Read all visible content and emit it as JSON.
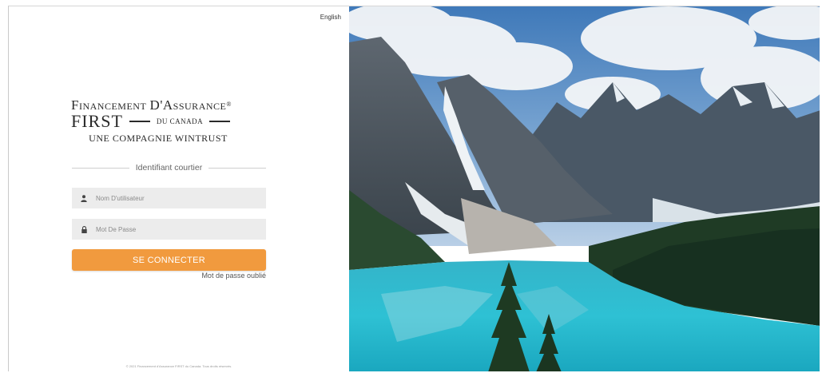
{
  "language_link": "English",
  "logo": {
    "line1_prefix": "F",
    "line1_rest": "INANCEMENT",
    "line1_d": "D'A",
    "line1_rest2": "SSURANCE",
    "registered": "®",
    "line2_first": "FIRST",
    "line2_canada": "DU CANADA",
    "line3": "UNE COMPAGNIE WINTRUST"
  },
  "form": {
    "section_title": "Identifiant courtier",
    "username_placeholder": "Nom D'utilisateur",
    "password_placeholder": "Mot De Passe",
    "login_button": "SE CONNECTER",
    "forgot_password": "Mot de passe oublié"
  },
  "footer": "© 2021 Financement d'Assurance FIRST du Canada. Tous droits réservés.",
  "icons": {
    "username": "user-icon",
    "password": "lock-icon"
  },
  "colors": {
    "accent": "#f19a3e",
    "field_bg": "#ececec"
  }
}
